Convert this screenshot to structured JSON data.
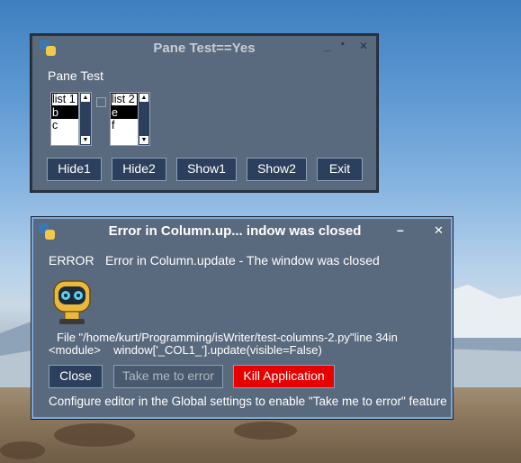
{
  "pane_window": {
    "title": "Pane Test==Yes",
    "controls": {
      "minimize": "_",
      "maximize": "▪",
      "close": "✕"
    },
    "label": "Pane Test",
    "list1": {
      "items": [
        "list 1",
        "b",
        "c"
      ],
      "selected": "b"
    },
    "list2": {
      "items": [
        "list 2",
        "e",
        "f"
      ],
      "selected": "e"
    },
    "buttons": {
      "hide1": "Hide1",
      "hide2": "Hide2",
      "show1": "Show1",
      "show2": "Show2",
      "exit": "Exit"
    }
  },
  "error_window": {
    "title": "Error in Column.up... indow was closed",
    "controls": {
      "minimize": "–",
      "close": "✕"
    },
    "error_label": "ERROR",
    "error_message": "Error in Column.update - The window was closed",
    "trace_line1": "File \"/home/kurt/Programming/isWriter/test-columns-2.py\"line 34in",
    "trace_line2": "<module>    window['_COL1_'].update(visible=False)",
    "buttons": {
      "close": "Close",
      "take_me": "Take me to error",
      "kill": "Kill Application"
    },
    "footer": "Configure editor in the Global settings to enable \"Take me to error\" feature"
  },
  "colors": {
    "window_bg": "#5a6a7e",
    "button_bg": "#2c3f5c",
    "kill_button": "#e60000",
    "error_window_border": "#7fa8d8"
  }
}
